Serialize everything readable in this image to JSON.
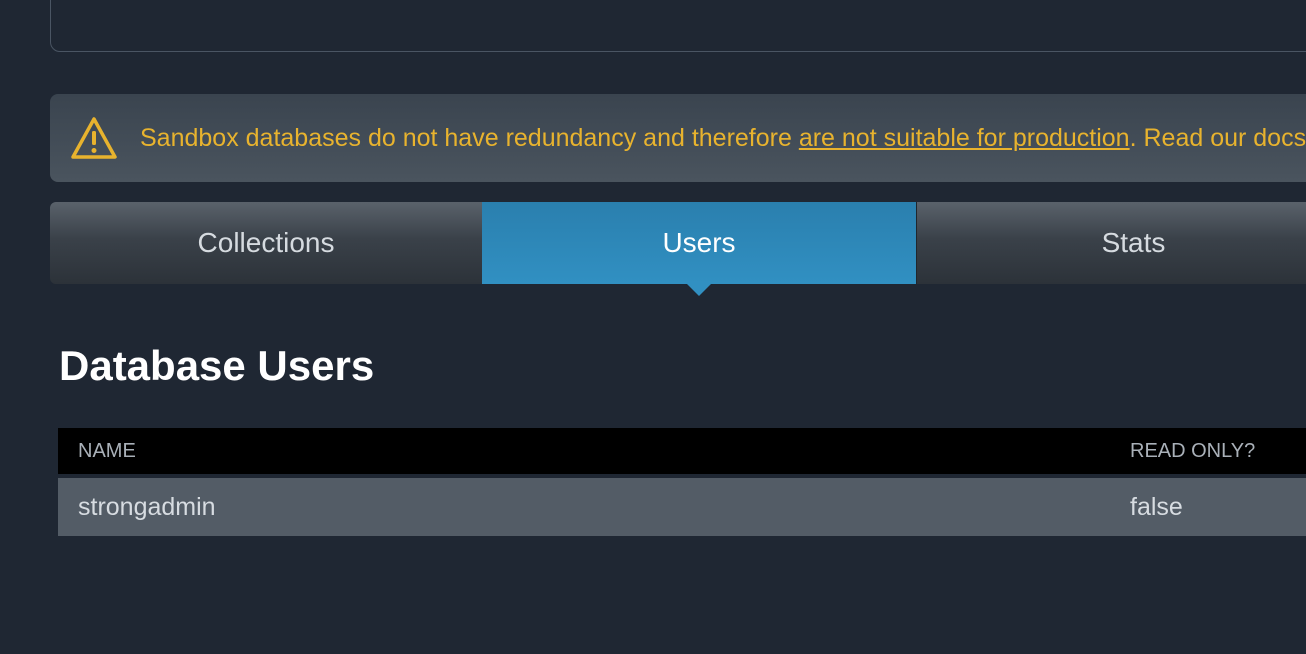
{
  "warning": {
    "text_before": "Sandbox databases do not have redundancy and therefore ",
    "link_text": "are not suitable for production",
    "text_after": ". Read our docs",
    "icon": "warning-triangle-icon",
    "color": "#e8b32e"
  },
  "tabs": [
    {
      "label": "Collections",
      "active": false
    },
    {
      "label": "Users",
      "active": true
    },
    {
      "label": "Stats",
      "active": false
    }
  ],
  "section": {
    "title": "Database Users"
  },
  "table": {
    "columns": [
      "NAME",
      "READ ONLY?"
    ],
    "rows": [
      {
        "name": "strongadmin",
        "read_only": "false"
      }
    ]
  },
  "colors": {
    "background": "#1f2733",
    "active_tab": "#3190c2",
    "warning": "#e8b32e"
  }
}
